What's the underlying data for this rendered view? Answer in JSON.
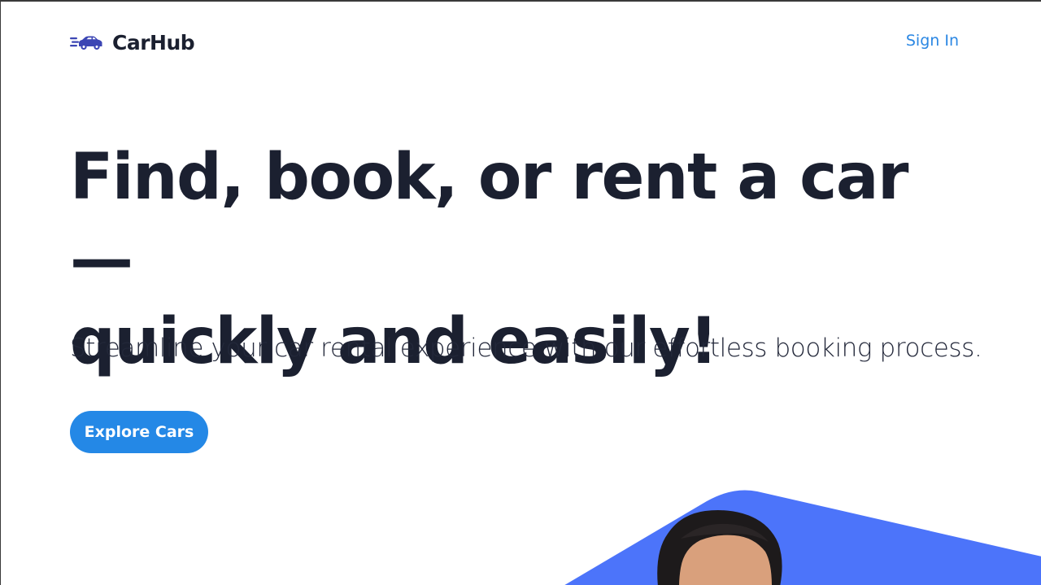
{
  "brand": {
    "name": "CarHub",
    "logo_icon": "fast-car-icon",
    "logo_color": "#3c46b4"
  },
  "nav": {
    "signin_label": "Sign In"
  },
  "hero": {
    "title_line1": "Find, book, or rent a car —",
    "title_line2": "quickly and easily!",
    "subtitle": "Streamline your car rental experience with our effortless booking process.",
    "cta_label": "Explore Cars"
  },
  "colors": {
    "text_dark": "#1b2030",
    "link_blue": "#2b87e3",
    "button_blue": "#2488e6",
    "hero_shape_blue": "#4c74fa"
  }
}
